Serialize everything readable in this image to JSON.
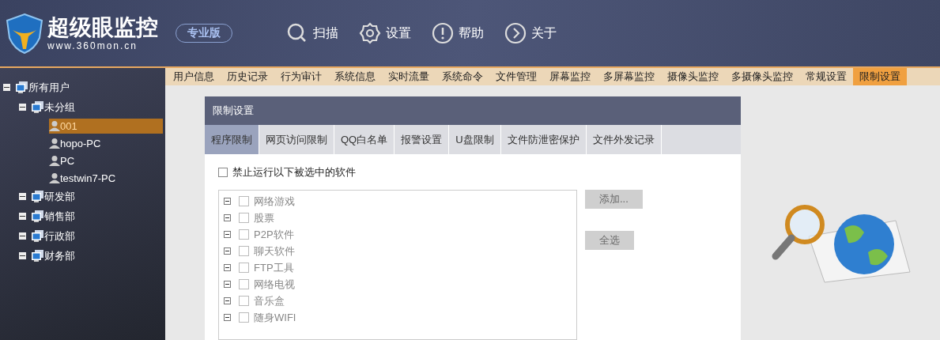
{
  "header": {
    "logo_title": "超级眼监控",
    "logo_url": "www.360mon.cn",
    "edition": "专业版",
    "toolbar": [
      {
        "kind": "scan",
        "label": "扫描"
      },
      {
        "kind": "settings",
        "label": "设置"
      },
      {
        "kind": "help",
        "label": "帮助"
      },
      {
        "kind": "about",
        "label": "关于"
      }
    ]
  },
  "sidebar": {
    "tree": [
      {
        "label": "所有用户",
        "kind": "group",
        "expanded": true,
        "children": [
          {
            "label": "未分组",
            "kind": "group",
            "expanded": true,
            "children": [
              {
                "label": "001",
                "kind": "user",
                "selected": true
              },
              {
                "label": "hopo-PC",
                "kind": "user",
                "selected": false
              },
              {
                "label": "PC",
                "kind": "user",
                "selected": false
              },
              {
                "label": "testwin7-PC",
                "kind": "user",
                "selected": false
              }
            ]
          },
          {
            "label": "研发部",
            "kind": "group",
            "expanded": true
          },
          {
            "label": "销售部",
            "kind": "group",
            "expanded": true
          },
          {
            "label": "行政部",
            "kind": "group",
            "expanded": true
          },
          {
            "label": "财务部",
            "kind": "group",
            "expanded": true
          }
        ]
      }
    ]
  },
  "tabs": [
    {
      "label": "用户信息",
      "selected": false
    },
    {
      "label": "历史记录",
      "selected": false
    },
    {
      "label": "行为审计",
      "selected": false
    },
    {
      "label": "系统信息",
      "selected": false
    },
    {
      "label": "实时流量",
      "selected": false
    },
    {
      "label": "系统命令",
      "selected": false
    },
    {
      "label": "文件管理",
      "selected": false
    },
    {
      "label": "屏幕监控",
      "selected": false
    },
    {
      "label": "多屏幕监控",
      "selected": false
    },
    {
      "label": "摄像头监控",
      "selected": false
    },
    {
      "label": "多摄像头监控",
      "selected": false
    },
    {
      "label": "常规设置",
      "selected": false
    },
    {
      "label": "限制设置",
      "selected": true
    }
  ],
  "panel": {
    "title": "限制设置",
    "subtabs": [
      {
        "label": "程序限制",
        "selected": true
      },
      {
        "label": "网页访问限制",
        "selected": false
      },
      {
        "label": "QQ白名单",
        "selected": false
      },
      {
        "label": "报警设置",
        "selected": false
      },
      {
        "label": "U盘限制",
        "selected": false
      },
      {
        "label": "文件防泄密保护",
        "selected": false
      },
      {
        "label": "文件外发记录",
        "selected": false
      }
    ],
    "block_option": {
      "label": "禁止运行以下被选中的软件",
      "checked": false
    },
    "software_list": {
      "disabled": true,
      "items": [
        {
          "label": "网络游戏",
          "checked": false,
          "expanded": true
        },
        {
          "label": "股票",
          "checked": false,
          "expanded": true
        },
        {
          "label": "P2P软件",
          "checked": false,
          "expanded": true
        },
        {
          "label": "聊天软件",
          "checked": false,
          "expanded": true
        },
        {
          "label": "FTP工具",
          "checked": false,
          "expanded": true
        },
        {
          "label": "网络电视",
          "checked": false,
          "expanded": true
        },
        {
          "label": "音乐盒",
          "checked": false,
          "expanded": true
        },
        {
          "label": "随身WIFI",
          "checked": false,
          "expanded": true
        }
      ]
    },
    "buttons": [
      {
        "label": "添加...",
        "disabled": true
      },
      {
        "label": "全选",
        "disabled": true
      }
    ]
  }
}
